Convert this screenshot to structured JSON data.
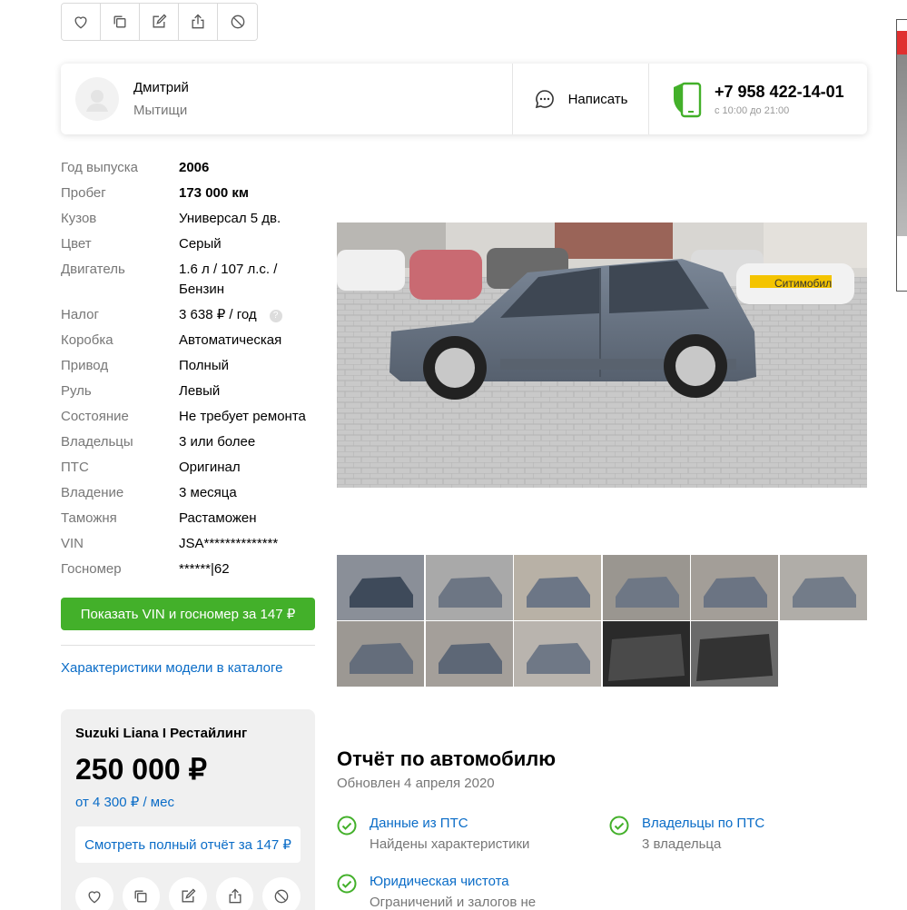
{
  "seller": {
    "name": "Дмитрий",
    "city": "Мытищи",
    "write_label": "Написать",
    "phone": "+7 958 422-14-01",
    "hours": "с 10:00 до 21:00"
  },
  "specs": [
    {
      "key": "Год выпуска",
      "value": "2006",
      "bold": true
    },
    {
      "key": "Пробег",
      "value": "173 000 км",
      "bold": true
    },
    {
      "key": "Кузов",
      "value": "Универсал 5 дв."
    },
    {
      "key": "Цвет",
      "value": "Серый"
    },
    {
      "key": "Двигатель",
      "value": "1.6 л / 107 л.с. / Бензин"
    },
    {
      "key": "Налог",
      "value": "3 638 ₽ / год"
    },
    {
      "key": "Коробка",
      "value": "Автоматическая"
    },
    {
      "key": "Привод",
      "value": "Полный"
    },
    {
      "key": "Руль",
      "value": "Левый"
    },
    {
      "key": "Состояние",
      "value": "Не требует ремонта"
    },
    {
      "key": "Владельцы",
      "value": "3 или более"
    },
    {
      "key": "ПТС",
      "value": "Оригинал"
    },
    {
      "key": "Владение",
      "value": "3 месяца"
    },
    {
      "key": "Таможня",
      "value": "Растаможен"
    },
    {
      "key": "VIN",
      "value": "JSA**************"
    },
    {
      "key": "Госномер",
      "value": "******|62"
    }
  ],
  "tax_help_icon": "?",
  "vin_button": "Показать VIN и госномер за 147 ₽",
  "catalog_link": "Характеристики модели в каталоге",
  "price_card": {
    "model": "Suzuki Liana I Рестайлинг",
    "price": "250 000 ₽",
    "credit": "от 4 300 ₽ / мес",
    "report_button": "Смотреть полный отчёт за 147 ₽"
  },
  "photo": {
    "taxi_label": "Ситимобил"
  },
  "report": {
    "title": "Отчёт по автомобилю",
    "updated": "Обновлен 4 апреля 2020",
    "items": [
      {
        "title": "Данные из ПТС",
        "sub": "Найдены характеристики"
      },
      {
        "title": "Владельцы по ПТС",
        "sub": "3 владельца"
      },
      {
        "title": "Юридическая чистота",
        "sub": "Ограничений и залогов не"
      }
    ]
  },
  "colors": {
    "accent_green": "#43b02a",
    "link_blue": "#0a6cc7",
    "muted_text": "#777777"
  },
  "icons": [
    "heart-icon",
    "copy-icon",
    "edit-icon",
    "share-icon",
    "block-icon",
    "chat-icon",
    "shield-phone-icon",
    "check-circle-icon"
  ]
}
